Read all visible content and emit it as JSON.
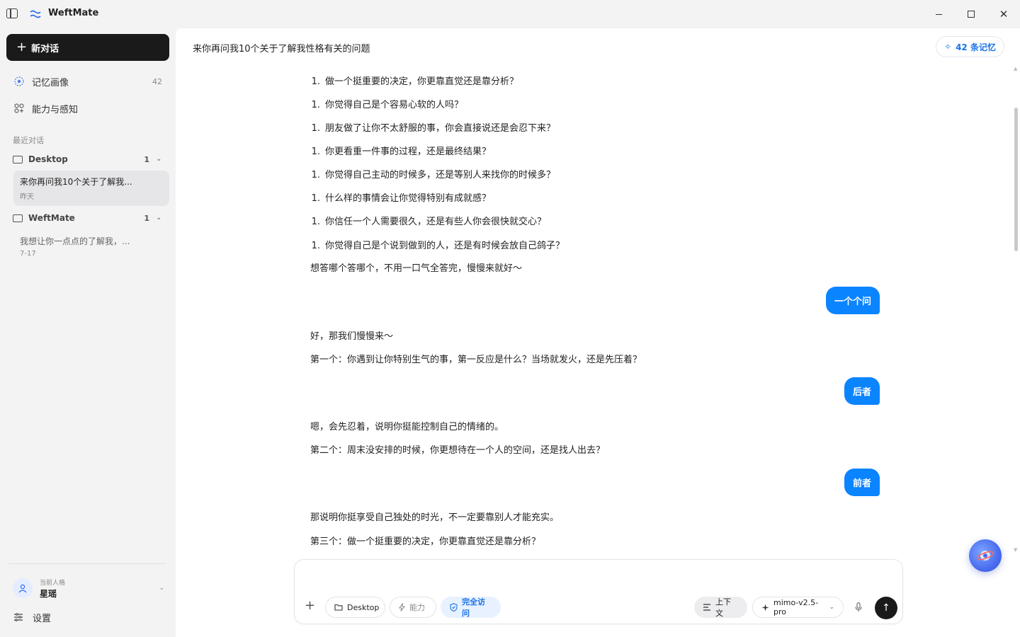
{
  "app": {
    "title": "WeftMate"
  },
  "window": {
    "close_glyph": "✕"
  },
  "sidebar": {
    "new_chat_plus": "+",
    "new_chat_label": "新对话",
    "nav": [
      {
        "label": "记忆画像",
        "count": "42",
        "icon": "memory-icon"
      },
      {
        "label": "能力与感知",
        "icon": "abilities-icon"
      }
    ],
    "recent_label": "最近对话",
    "folders": [
      {
        "name": "Desktop",
        "count": "1",
        "conversations": [
          {
            "title": "来你再问我10个关于了解我...",
            "date": "昨天"
          }
        ]
      },
      {
        "name": "WeftMate",
        "count": "1",
        "conversations": [
          {
            "title": "我想让你一点点的了解我，...",
            "date": "7-17"
          }
        ]
      }
    ],
    "chevron": "⌄",
    "persona": {
      "label": "当前人格",
      "name": "星瑶"
    },
    "settings_label": "设置"
  },
  "header": {
    "title": "来你再问我10个关于了解我性格有关的问题",
    "memory_star": "✧",
    "memory_button": "42 条记忆"
  },
  "messages": {
    "list_number": "1.",
    "list": [
      "做一个挺重要的决定，你更靠直觉还是靠分析？",
      "你觉得自己是个容易心软的人吗？",
      "朋友做了让你不太舒服的事，你会直接说还是会忍下来？",
      "你更看重一件事的过程，还是最终结果？",
      "你觉得自己主动的时候多，还是等别人来找你的时候多？",
      "什么样的事情会让你觉得特别有成就感？",
      "你信任一个人需要很久，还是有些人你会很快就交心？",
      "你觉得自己是个说到做到的人，还是有时候会放自己鸽子？"
    ],
    "after_list": "想答哪个答哪个，不用一口气全答完，慢慢来就好～",
    "user_1": "一个个问",
    "reply_1a": "好，那我们慢慢来～",
    "reply_1b": "第一个：你遇到让你特别生气的事，第一反应是什么？当场就发火，还是先压着？",
    "user_2": "后者",
    "reply_2a": "嗯，会先忍着，说明你挺能控制自己的情绪的。",
    "reply_2b": "第二个：周末没安排的时候，你更想待在一个人的空间，还是找人出去？",
    "user_3": "前者",
    "reply_3a": "那说明你挺享受自己独处的时光，不一定要靠别人才能充实。",
    "reply_3b": "第三个：做一个挺重要的决定，你更靠直觉还是靠分析？"
  },
  "composer": {
    "placeholder": "",
    "plus": "+",
    "pills": {
      "desktop": "Desktop",
      "ability": "能力",
      "access": "完全访问",
      "context": "上下文",
      "model": "mimo-v2.5-pro"
    },
    "model_chevron": "⌄",
    "send_arrow": "↑"
  },
  "colors": {
    "accent": "#0a84ff",
    "link": "#1a73e8",
    "dark": "#1a1a1a"
  }
}
